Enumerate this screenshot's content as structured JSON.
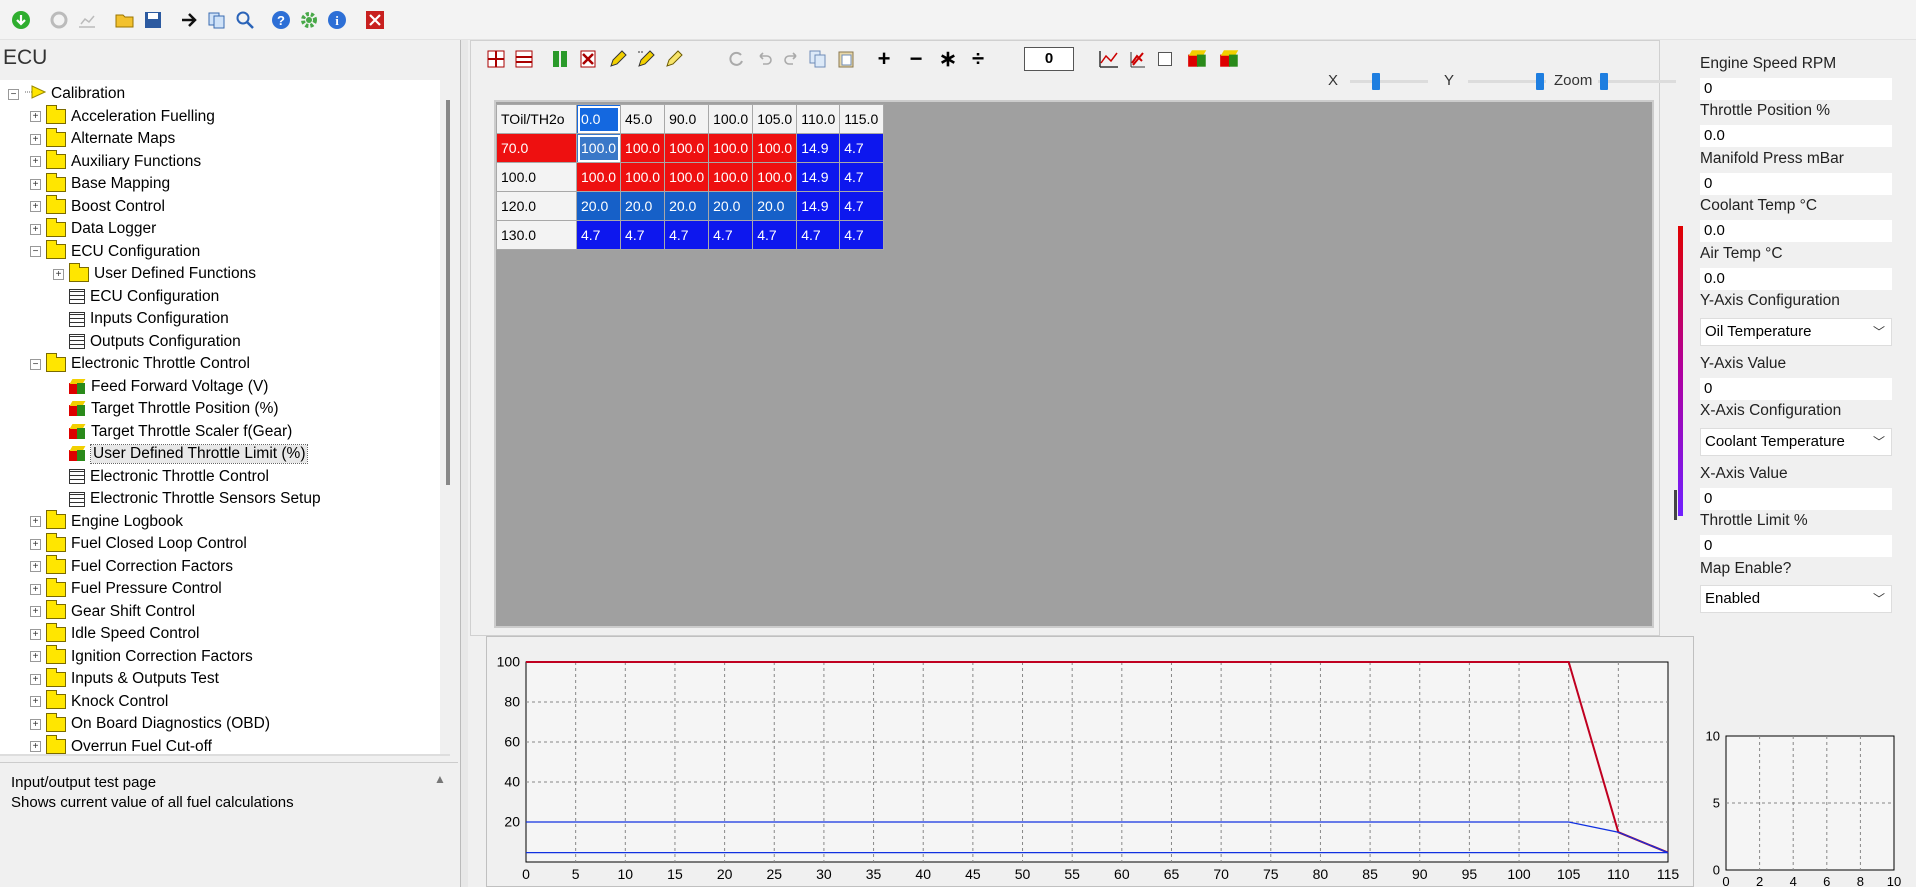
{
  "panel_title": "ECU",
  "tree": [
    {
      "label": "Calibration",
      "level": 0,
      "type": "root",
      "expander": "−"
    },
    {
      "label": "Acceleration Fuelling",
      "level": 1,
      "type": "folder",
      "expander": "+"
    },
    {
      "label": "Alternate Maps",
      "level": 1,
      "type": "folder",
      "expander": "+"
    },
    {
      "label": "Auxiliary Functions",
      "level": 1,
      "type": "folder",
      "expander": "+"
    },
    {
      "label": "Base Mapping",
      "level": 1,
      "type": "folder",
      "expander": "+"
    },
    {
      "label": "Boost Control",
      "level": 1,
      "type": "folder",
      "expander": "+"
    },
    {
      "label": "Data Logger",
      "level": 1,
      "type": "folder",
      "expander": "+"
    },
    {
      "label": "ECU Configuration",
      "level": 1,
      "type": "folder",
      "expander": "−"
    },
    {
      "label": "User Defined Functions",
      "level": 2,
      "type": "folder",
      "expander": "+"
    },
    {
      "label": "ECU Configuration",
      "level": 2,
      "type": "table",
      "expander": ""
    },
    {
      "label": "Inputs Configuration",
      "level": 2,
      "type": "table",
      "expander": ""
    },
    {
      "label": "Outputs Configuration",
      "level": 2,
      "type": "table",
      "expander": ""
    },
    {
      "label": "Electronic Throttle Control",
      "level": 1,
      "type": "folder",
      "expander": "−"
    },
    {
      "label": "Feed Forward Voltage (V)",
      "level": 2,
      "type": "map",
      "expander": ""
    },
    {
      "label": "Target Throttle Position (%)",
      "level": 2,
      "type": "map",
      "expander": ""
    },
    {
      "label": "Target Throttle Scaler f(Gear)",
      "level": 2,
      "type": "map",
      "expander": ""
    },
    {
      "label": "User Defined Throttle Limit (%)",
      "level": 2,
      "type": "map",
      "expander": "",
      "selected": true
    },
    {
      "label": "Electronic Throttle Control",
      "level": 2,
      "type": "table",
      "expander": ""
    },
    {
      "label": "Electronic Throttle Sensors Setup",
      "level": 2,
      "type": "table",
      "expander": ""
    },
    {
      "label": "Engine Logbook",
      "level": 1,
      "type": "folder",
      "expander": "+"
    },
    {
      "label": "Fuel Closed Loop Control",
      "level": 1,
      "type": "folder",
      "expander": "+"
    },
    {
      "label": "Fuel Correction Factors",
      "level": 1,
      "type": "folder",
      "expander": "+"
    },
    {
      "label": "Fuel Pressure Control",
      "level": 1,
      "type": "folder",
      "expander": "+"
    },
    {
      "label": "Gear Shift Control",
      "level": 1,
      "type": "folder",
      "expander": "+"
    },
    {
      "label": "Idle Speed Control",
      "level": 1,
      "type": "folder",
      "expander": "+"
    },
    {
      "label": "Ignition Correction Factors",
      "level": 1,
      "type": "folder",
      "expander": "+"
    },
    {
      "label": "Inputs & Outputs Test",
      "level": 1,
      "type": "folder",
      "expander": "+"
    },
    {
      "label": "Knock Control",
      "level": 1,
      "type": "folder",
      "expander": "+"
    },
    {
      "label": "On Board Diagnostics (OBD)",
      "level": 1,
      "type": "folder",
      "expander": "+"
    },
    {
      "label": "Overrun Fuel Cut-off",
      "level": 1,
      "type": "folder",
      "expander": "+"
    }
  ],
  "description": {
    "line1": "Input/output test page",
    "line2": "Shows current value of all fuel calculations"
  },
  "map_toolbar": {
    "step_value": "0",
    "x_label": "X",
    "y_label": "Y",
    "zoom_label": "Zoom"
  },
  "table": {
    "corner": "TOil/TH2o",
    "columns": [
      "0.0",
      "45.0",
      "90.0",
      "100.0",
      "105.0",
      "110.0",
      "115.0"
    ],
    "rows": [
      {
        "label": "70.0",
        "values": [
          "100.0",
          "100.0",
          "100.0",
          "100.0",
          "100.0",
          "14.9",
          "4.7"
        ]
      },
      {
        "label": "100.0",
        "values": [
          "100.0",
          "100.0",
          "100.0",
          "100.0",
          "100.0",
          "14.9",
          "4.7"
        ]
      },
      {
        "label": "120.0",
        "values": [
          "20.0",
          "20.0",
          "20.0",
          "20.0",
          "20.0",
          "14.9",
          "4.7"
        ]
      },
      {
        "label": "130.0",
        "values": [
          "4.7",
          "4.7",
          "4.7",
          "4.7",
          "4.7",
          "4.7",
          "4.7"
        ]
      }
    ]
  },
  "right_panel": {
    "engine_speed_label": "Engine Speed RPM",
    "engine_speed_value": "0",
    "throttle_pos_label": "Throttle Position %",
    "throttle_pos_value": "0.0",
    "manifold_label": "Manifold Press mBar",
    "manifold_value": "0",
    "coolant_label": "Coolant Temp °C",
    "coolant_value": "0.0",
    "air_label": "Air Temp °C",
    "air_value": "0.0",
    "y_axis_config_label": "Y-Axis Configuration",
    "y_axis_config_value": "Oil Temperature",
    "y_axis_value_label": "Y-Axis Value",
    "y_axis_value": "0",
    "x_axis_config_label": "X-Axis Configuration",
    "x_axis_config_value": "Coolant Temperature",
    "x_axis_value_label": "X-Axis Value",
    "x_axis_value": "0",
    "throttle_limit_label": "Throttle Limit %",
    "throttle_limit_value": "0",
    "map_enable_label": "Map Enable?",
    "map_enable_value": "Enabled"
  },
  "chart_data": [
    {
      "type": "line",
      "x": [
        0,
        45,
        90,
        100,
        105,
        110,
        115
      ],
      "xlim": [
        0,
        115
      ],
      "ylim": [
        0,
        100
      ],
      "xticks": [
        0,
        5,
        10,
        15,
        20,
        25,
        30,
        35,
        40,
        45,
        50,
        55,
        60,
        65,
        70,
        75,
        80,
        85,
        90,
        95,
        100,
        105,
        110,
        115
      ],
      "yticks": [
        20,
        40,
        60,
        80,
        100
      ],
      "grid": true,
      "series": [
        {
          "values": [
            100,
            100,
            100,
            100,
            100,
            14.9,
            4.7
          ],
          "color": "#1030e0"
        },
        {
          "values": [
            100,
            100,
            100,
            100,
            100,
            14.9,
            4.7
          ],
          "color": "#c00020"
        },
        {
          "values": [
            20,
            20,
            20,
            20,
            20,
            14.9,
            4.7
          ],
          "color": "#1030e0"
        },
        {
          "values": [
            4.7,
            4.7,
            4.7,
            4.7,
            4.7,
            4.7,
            4.7
          ],
          "color": "#1030e0"
        }
      ]
    },
    {
      "type": "line",
      "xlim": [
        0,
        10
      ],
      "ylim": [
        0,
        10
      ],
      "xticks": [
        0,
        2,
        4,
        6,
        8,
        10
      ],
      "yticks": [
        0,
        5,
        10
      ],
      "grid": true,
      "series": []
    }
  ]
}
